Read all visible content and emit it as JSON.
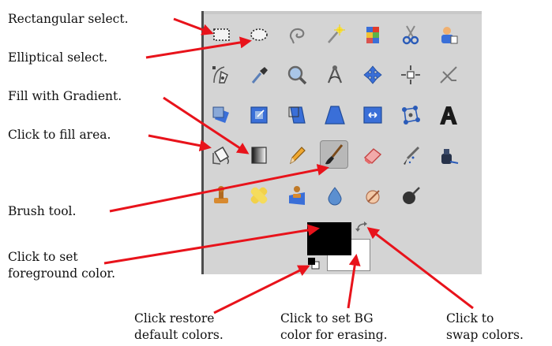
{
  "annotations": {
    "rect_select": "Rectangular select.",
    "ellipse_select": "Elliptical select.",
    "gradient": "Fill with Gradient.",
    "bucket_fill": "Click to fill area.",
    "brush": "Brush tool.",
    "fg_color": [
      "Click to set",
      "foreground color."
    ],
    "default_colors": [
      "Click restore",
      "default colors."
    ],
    "bg_color": [
      "Click to set BG",
      "color for erasing."
    ],
    "swap_colors": [
      "Click to",
      "swap colors."
    ]
  },
  "toolbox": {
    "tools": [
      [
        "rect-select-icon",
        "ellipse-select-icon",
        "free-select-icon",
        "fuzzy-select-icon",
        "select-by-color-icon",
        "scissors-select-icon",
        "foreground-select-icon"
      ],
      [
        "paths-icon",
        "color-picker-icon",
        "zoom-icon",
        "measure-icon",
        "move-icon",
        "alignment-icon",
        "crop-icon"
      ],
      [
        "rotate-icon",
        "scale-icon",
        "shear-icon",
        "perspective-icon",
        "flip-icon",
        "cage-transform-icon",
        "text-icon"
      ],
      [
        "bucket-fill-icon",
        "blend-icon",
        "pencil-icon",
        "paintbrush-icon",
        "eraser-icon",
        "airbrush-icon",
        "ink-icon"
      ],
      [
        "clone-icon",
        "heal-icon",
        "perspective-clone-icon",
        "blur-sharpen-icon",
        "smudge-icon",
        "dodge-burn-icon"
      ]
    ],
    "active_tool": "paintbrush-icon",
    "foreground_color": "#000000",
    "background_color": "#ffffff"
  },
  "colors": {
    "arrow": "#e8131b",
    "toolbox_bg": "#d4d4d4"
  }
}
